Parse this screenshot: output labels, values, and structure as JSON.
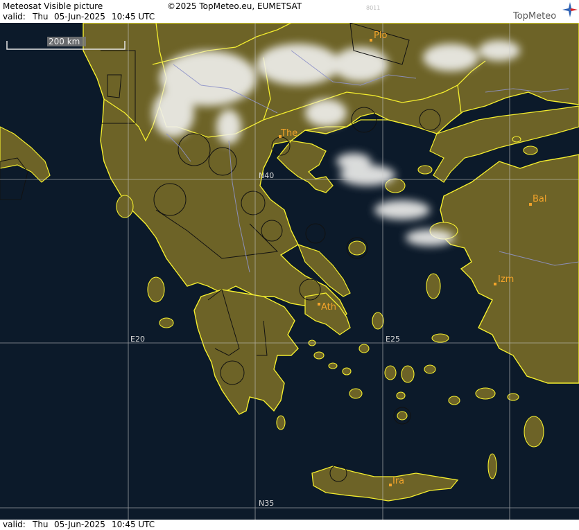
{
  "header": {
    "title": "Meteosat Visible picture",
    "copyright": "©2025 TopMeteo.eu, EUMETSAT",
    "code": "8011",
    "valid_label": "valid:",
    "valid_day": "Thu",
    "valid_date": "05-Jun-2025",
    "valid_time": "10:45 UTC",
    "logo_text": "TopMeteo"
  },
  "footer": {
    "valid_label": "valid:",
    "valid_day": "Thu",
    "valid_date": "05-Jun-2025",
    "valid_time": "10:45 UTC"
  },
  "scale_bar": {
    "label": "200 km"
  },
  "grid": {
    "lat_n40": "N40",
    "lat_n35": "N35",
    "lon_e20": "E20",
    "lon_e25": "E25"
  },
  "cities": [
    {
      "id": "plo",
      "label": "Plo"
    },
    {
      "id": "the",
      "label": "The"
    },
    {
      "id": "bal",
      "label": "Bal"
    },
    {
      "id": "izm",
      "label": "Izm"
    },
    {
      "id": "ath",
      "label": "Ath"
    },
    {
      "id": "ira",
      "label": "Ira"
    }
  ],
  "colors": {
    "sea": "#0c1a2a",
    "land": "#6d6327",
    "land_dark": "#4f4a1f",
    "border": "#f4ee2e",
    "coast": "#f4ee2e",
    "cloud": "#f1f1ef",
    "city": "#f2a32a",
    "grid": "#c8c8c8"
  }
}
